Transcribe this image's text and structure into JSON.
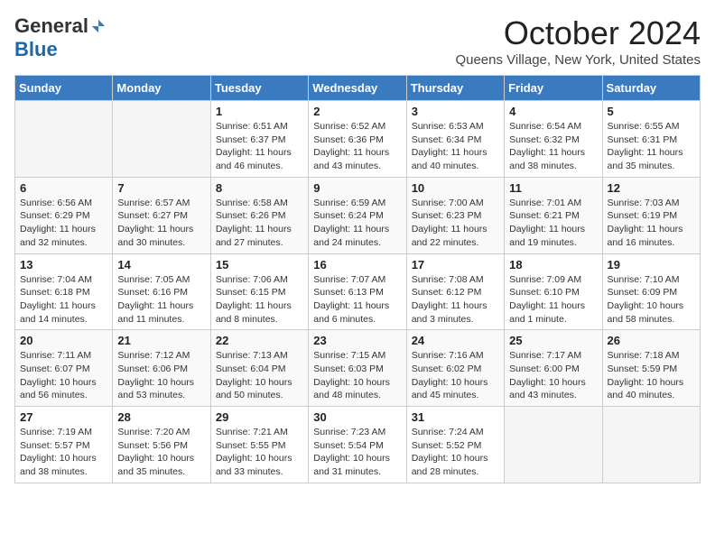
{
  "header": {
    "logo_general": "General",
    "logo_blue": "Blue",
    "month_title": "October 2024",
    "location": "Queens Village, New York, United States"
  },
  "days_of_week": [
    "Sunday",
    "Monday",
    "Tuesday",
    "Wednesday",
    "Thursday",
    "Friday",
    "Saturday"
  ],
  "weeks": [
    [
      {
        "num": "",
        "detail": "",
        "empty": true
      },
      {
        "num": "",
        "detail": "",
        "empty": true
      },
      {
        "num": "1",
        "detail": "Sunrise: 6:51 AM\nSunset: 6:37 PM\nDaylight: 11 hours and 46 minutes."
      },
      {
        "num": "2",
        "detail": "Sunrise: 6:52 AM\nSunset: 6:36 PM\nDaylight: 11 hours and 43 minutes."
      },
      {
        "num": "3",
        "detail": "Sunrise: 6:53 AM\nSunset: 6:34 PM\nDaylight: 11 hours and 40 minutes."
      },
      {
        "num": "4",
        "detail": "Sunrise: 6:54 AM\nSunset: 6:32 PM\nDaylight: 11 hours and 38 minutes."
      },
      {
        "num": "5",
        "detail": "Sunrise: 6:55 AM\nSunset: 6:31 PM\nDaylight: 11 hours and 35 minutes."
      }
    ],
    [
      {
        "num": "6",
        "detail": "Sunrise: 6:56 AM\nSunset: 6:29 PM\nDaylight: 11 hours and 32 minutes."
      },
      {
        "num": "7",
        "detail": "Sunrise: 6:57 AM\nSunset: 6:27 PM\nDaylight: 11 hours and 30 minutes."
      },
      {
        "num": "8",
        "detail": "Sunrise: 6:58 AM\nSunset: 6:26 PM\nDaylight: 11 hours and 27 minutes."
      },
      {
        "num": "9",
        "detail": "Sunrise: 6:59 AM\nSunset: 6:24 PM\nDaylight: 11 hours and 24 minutes."
      },
      {
        "num": "10",
        "detail": "Sunrise: 7:00 AM\nSunset: 6:23 PM\nDaylight: 11 hours and 22 minutes."
      },
      {
        "num": "11",
        "detail": "Sunrise: 7:01 AM\nSunset: 6:21 PM\nDaylight: 11 hours and 19 minutes."
      },
      {
        "num": "12",
        "detail": "Sunrise: 7:03 AM\nSunset: 6:19 PM\nDaylight: 11 hours and 16 minutes."
      }
    ],
    [
      {
        "num": "13",
        "detail": "Sunrise: 7:04 AM\nSunset: 6:18 PM\nDaylight: 11 hours and 14 minutes."
      },
      {
        "num": "14",
        "detail": "Sunrise: 7:05 AM\nSunset: 6:16 PM\nDaylight: 11 hours and 11 minutes."
      },
      {
        "num": "15",
        "detail": "Sunrise: 7:06 AM\nSunset: 6:15 PM\nDaylight: 11 hours and 8 minutes."
      },
      {
        "num": "16",
        "detail": "Sunrise: 7:07 AM\nSunset: 6:13 PM\nDaylight: 11 hours and 6 minutes."
      },
      {
        "num": "17",
        "detail": "Sunrise: 7:08 AM\nSunset: 6:12 PM\nDaylight: 11 hours and 3 minutes."
      },
      {
        "num": "18",
        "detail": "Sunrise: 7:09 AM\nSunset: 6:10 PM\nDaylight: 11 hours and 1 minute."
      },
      {
        "num": "19",
        "detail": "Sunrise: 7:10 AM\nSunset: 6:09 PM\nDaylight: 10 hours and 58 minutes."
      }
    ],
    [
      {
        "num": "20",
        "detail": "Sunrise: 7:11 AM\nSunset: 6:07 PM\nDaylight: 10 hours and 56 minutes."
      },
      {
        "num": "21",
        "detail": "Sunrise: 7:12 AM\nSunset: 6:06 PM\nDaylight: 10 hours and 53 minutes."
      },
      {
        "num": "22",
        "detail": "Sunrise: 7:13 AM\nSunset: 6:04 PM\nDaylight: 10 hours and 50 minutes."
      },
      {
        "num": "23",
        "detail": "Sunrise: 7:15 AM\nSunset: 6:03 PM\nDaylight: 10 hours and 48 minutes."
      },
      {
        "num": "24",
        "detail": "Sunrise: 7:16 AM\nSunset: 6:02 PM\nDaylight: 10 hours and 45 minutes."
      },
      {
        "num": "25",
        "detail": "Sunrise: 7:17 AM\nSunset: 6:00 PM\nDaylight: 10 hours and 43 minutes."
      },
      {
        "num": "26",
        "detail": "Sunrise: 7:18 AM\nSunset: 5:59 PM\nDaylight: 10 hours and 40 minutes."
      }
    ],
    [
      {
        "num": "27",
        "detail": "Sunrise: 7:19 AM\nSunset: 5:57 PM\nDaylight: 10 hours and 38 minutes."
      },
      {
        "num": "28",
        "detail": "Sunrise: 7:20 AM\nSunset: 5:56 PM\nDaylight: 10 hours and 35 minutes."
      },
      {
        "num": "29",
        "detail": "Sunrise: 7:21 AM\nSunset: 5:55 PM\nDaylight: 10 hours and 33 minutes."
      },
      {
        "num": "30",
        "detail": "Sunrise: 7:23 AM\nSunset: 5:54 PM\nDaylight: 10 hours and 31 minutes."
      },
      {
        "num": "31",
        "detail": "Sunrise: 7:24 AM\nSunset: 5:52 PM\nDaylight: 10 hours and 28 minutes."
      },
      {
        "num": "",
        "detail": "",
        "empty": true
      },
      {
        "num": "",
        "detail": "",
        "empty": true
      }
    ]
  ]
}
